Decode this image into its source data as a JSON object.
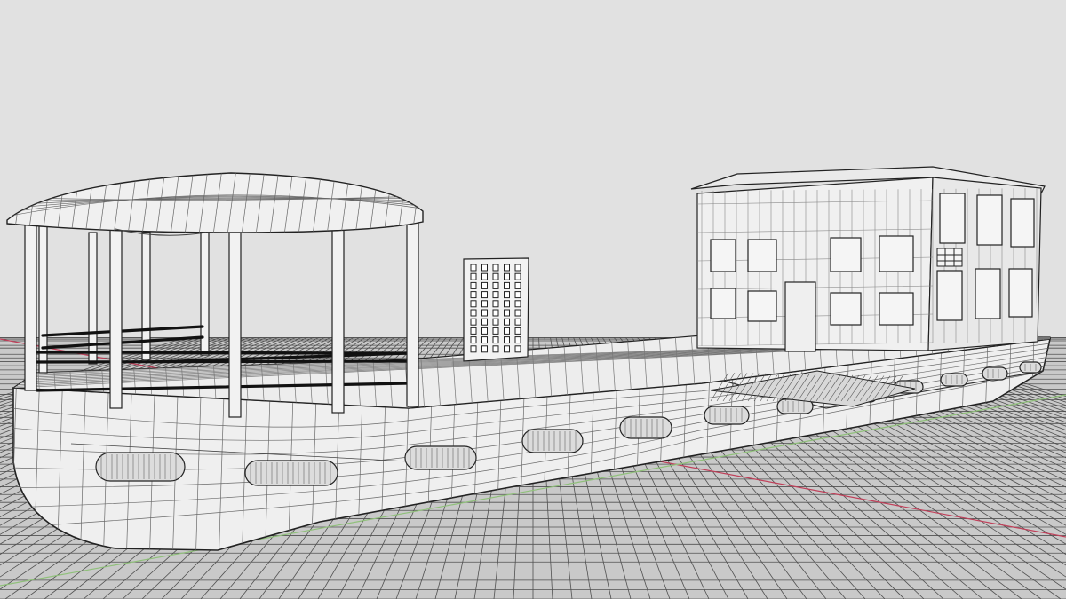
{
  "viewport": {
    "view_mode": "wireframe",
    "background_color": "#e1e1e1",
    "grid": {
      "visible": true,
      "line_color": "#505050",
      "floor_color": "#c9c9c9"
    },
    "axes": {
      "x_axis_color": "#c0405a",
      "y_axis_color": "#8fc07a"
    }
  },
  "model": {
    "object": "houseboat",
    "parts": [
      "hull",
      "portholes",
      "deck",
      "canopy-roof",
      "canopy-posts",
      "deck-railing",
      "vent-panel",
      "cabin",
      "cabin-windows",
      "cabin-door",
      "stern-ramp"
    ],
    "porthole_count": 12,
    "canopy_post_count": 8,
    "railing_rail_count": 3
  }
}
